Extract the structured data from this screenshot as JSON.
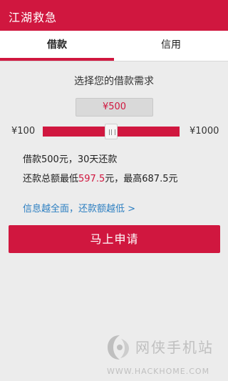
{
  "app": {
    "title": "江湖救急"
  },
  "tabs": [
    {
      "label": "借款",
      "active": true
    },
    {
      "label": "信用",
      "active": false
    }
  ],
  "loan": {
    "prompt": "选择您的借款需求",
    "amount_display": "¥500",
    "slider": {
      "min_label": "¥100",
      "max_label": "¥1000",
      "min": 100,
      "max": 1000,
      "value": 500
    },
    "summary_line1": "借款500元，30天还款",
    "repay": {
      "prefix": "还款总额最低",
      "min_value": "597.5",
      "middle": "元，最高",
      "max_value": "687.5",
      "suffix": "元"
    },
    "info_link": "信息越全面，还款额越低 >",
    "apply_label": "马上申请"
  },
  "watermark": {
    "text": "网侠手机站",
    "url": "WWW.HACKHOME.COM"
  },
  "colors": {
    "accent": "#d0173f",
    "link": "#2d7fc1",
    "background": "#ececec"
  }
}
